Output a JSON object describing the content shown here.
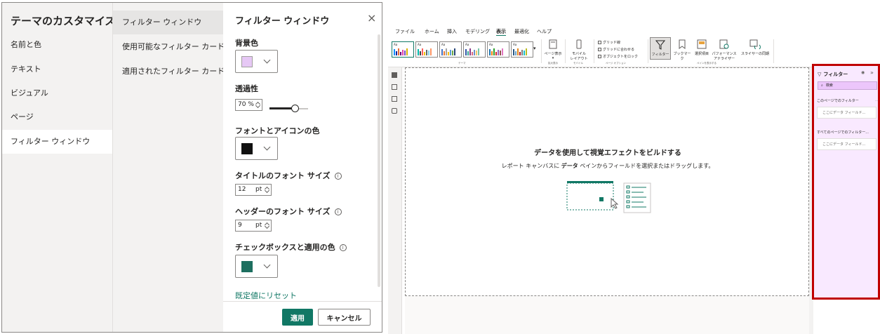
{
  "dialog": {
    "left_title": "テーマのカスタマイズ",
    "left_nav": [
      "名前と色",
      "テキスト",
      "ビジュアル",
      "ページ",
      "フィルター ウィンドウ"
    ],
    "mid_nav": [
      "フィルター ウィンドウ",
      "使用可能なフィルター カード",
      "適用されたフィルター カード"
    ],
    "panel_title": "フィルター ウィンドウ",
    "close_glyph": "×",
    "background_label": "背景色",
    "background_color": "#e6c8f5",
    "transparency_label": "透過性",
    "transparency_value": "70 %",
    "transparency_percent": 70,
    "font_icon_color_label": "フォントとアイコンの色",
    "font_icon_color": "#111111",
    "title_font_size_label": "タイトルのフォント サイズ",
    "title_font_size": "12",
    "header_font_size_label": "ヘッダーのフォント サイズ",
    "header_font_size": "9",
    "unit": "pt",
    "checkbox_color_label": "チェックボックスと適用の色",
    "checkbox_color": "#1d6f5f",
    "info_glyph": "i",
    "reset_label": "既定値にリセット",
    "apply_label": "適用",
    "cancel_label": "キャンセル"
  },
  "pbi": {
    "menu": [
      "ファイル",
      "ホーム",
      "挿入",
      "モデリング",
      "表示",
      "最適化",
      "ヘルプ"
    ],
    "active_menu": "表示",
    "ribbon": {
      "theme_group": "テーマ",
      "page_view": "ページ表示",
      "page_view_group": "拡大表示",
      "mobile_layout_1": "モバイル",
      "mobile_layout_2": "レイアウト",
      "mobile_group": "モバイル",
      "checks": [
        "グリッド線",
        "グリッドに合わせる",
        "オブジェクトをロック"
      ],
      "page_options_group": "ページ オプション",
      "panes": [
        "フィルター",
        "ブックマーク",
        "選択項目",
        "パフォーマンス",
        "スライサーの同期"
      ],
      "perf_analyzer_2": "アナライザー",
      "panes_group": "ペインを表示する"
    },
    "canvas_title": "データを使用して視覚エフェクトをビルドする",
    "canvas_sub_pre": "レポート キャンバスに",
    "canvas_sub_bold": "データ",
    "canvas_sub_post": "ペインからフィールドを選択またはドラッグします。",
    "filter_pane": {
      "title": "フィルター",
      "search_placeholder": "検索",
      "this_page": "このページでのフィルター",
      "all_pages": "すべてのページでのフィルター...",
      "well": "ここにデータ フィールド...",
      "dots": "..."
    }
  }
}
